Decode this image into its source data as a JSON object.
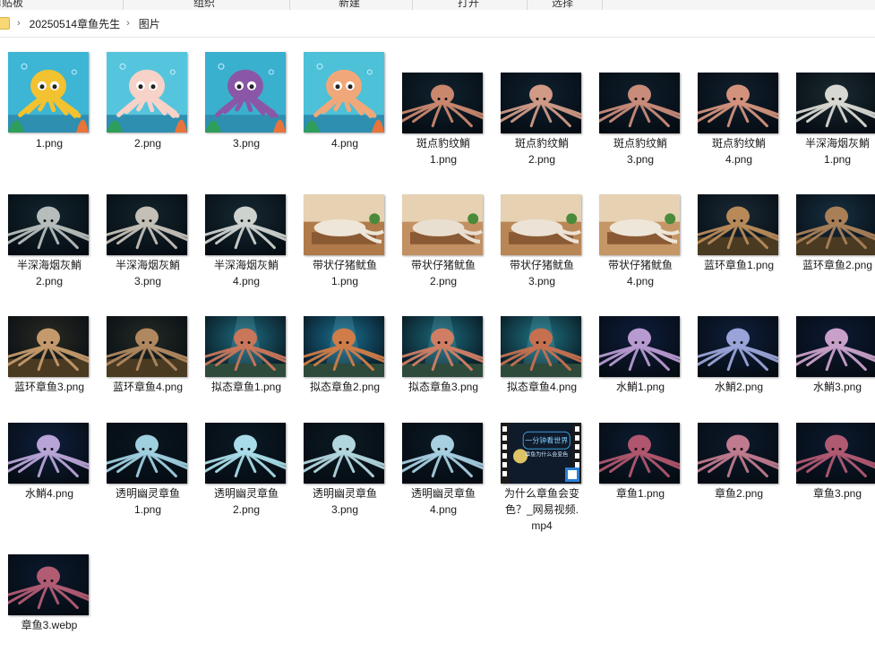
{
  "ribbon": {
    "groups": [
      "剪贴板",
      "组织",
      "新建",
      "打开",
      "选择"
    ]
  },
  "address": {
    "crumbs": [
      "20250514章鱼先生",
      "图片"
    ]
  },
  "colors": {
    "cartoon_bg": "#3fb6d8",
    "dark_bg": "#0d1e2e",
    "selection": "#cce8ff"
  },
  "files": [
    {
      "name": [
        "1.png"
      ],
      "kind": "cartoon",
      "octo": "#f2c230",
      "bg": "#3db5d5"
    },
    {
      "name": [
        "2.png"
      ],
      "kind": "cartoon",
      "octo": "#f7d2c8",
      "bg": "#55c5dd"
    },
    {
      "name": [
        "3.png"
      ],
      "kind": "cartoon",
      "octo": "#8a57a6",
      "bg": "#3ab0cf"
    },
    {
      "name": [
        "4.png"
      ],
      "kind": "cartoon",
      "octo": "#f0a87a",
      "bg": "#4cc1d8"
    },
    {
      "name": [
        "斑点豹纹鮹",
        "1.png"
      ],
      "kind": "dark",
      "octo": "#c9876e",
      "bg": "#10232f"
    },
    {
      "name": [
        "斑点豹纹鮹",
        "2.png"
      ],
      "kind": "dark",
      "octo": "#d09a86",
      "bg": "#0f2130"
    },
    {
      "name": [
        "斑点豹纹鮹",
        "3.png"
      ],
      "kind": "dark",
      "octo": "#c98b7a",
      "bg": "#0e1f2c"
    },
    {
      "name": [
        "斑点豹纹鮹",
        "4.png"
      ],
      "kind": "dark",
      "octo": "#d3927c",
      "bg": "#11202e"
    },
    {
      "name": [
        "半深海烟灰鮹",
        "1.png"
      ],
      "kind": "dark",
      "octo": "#d8d8d2",
      "bg": "#1b2a30"
    },
    {
      "name": [
        "半深海烟灰鮹",
        "2.png"
      ],
      "kind": "dark",
      "octo": "#b7bdbb",
      "bg": "#12262e"
    },
    {
      "name": [
        "半深海烟灰鮹",
        "3.png"
      ],
      "kind": "dark",
      "octo": "#c4c0b6",
      "bg": "#14242c"
    },
    {
      "name": [
        "半深海烟灰鮹",
        "4.png"
      ],
      "kind": "dark",
      "octo": "#cdd2cf",
      "bg": "#162a33"
    },
    {
      "name": [
        "带状仔猪鱿鱼",
        "1.png"
      ],
      "kind": "kitchen",
      "octo": "#eee6d8",
      "bg": "#b07a4a"
    },
    {
      "name": [
        "带状仔猪鱿鱼",
        "2.png"
      ],
      "kind": "kitchen",
      "octo": "#e9dfd1",
      "bg": "#c29062"
    },
    {
      "name": [
        "带状仔猪鱿鱼",
        "3.png"
      ],
      "kind": "kitchen",
      "octo": "#ece3d6",
      "bg": "#b98656"
    },
    {
      "name": [
        "带状仔猪鱿鱼",
        "4.png"
      ],
      "kind": "kitchen",
      "octo": "#efe6da",
      "bg": "#c59766"
    },
    {
      "name": [
        "蓝环章鱼1.png"
      ],
      "kind": "reef",
      "octo": "#b88a5a",
      "bg": "#1a2a35"
    },
    {
      "name": [
        "蓝环章鱼2.png"
      ],
      "kind": "reef",
      "octo": "#a97f58",
      "bg": "#173041"
    },
    {
      "name": [
        "蓝环章鱼3.png"
      ],
      "kind": "reef",
      "octo": "#c49a6c",
      "bg": "#2a2a22"
    },
    {
      "name": [
        "蓝环章鱼4.png"
      ],
      "kind": "reef",
      "octo": "#b08860",
      "bg": "#232a24"
    },
    {
      "name": [
        "拟态章鱼1.png"
      ],
      "kind": "teal",
      "octo": "#c9765a",
      "bg": "#1e6c80"
    },
    {
      "name": [
        "拟态章鱼2.png"
      ],
      "kind": "teal",
      "octo": "#d07c48",
      "bg": "#1a7092"
    },
    {
      "name": [
        "拟态章鱼3.png"
      ],
      "kind": "teal",
      "octo": "#cf7e64",
      "bg": "#1c6a7c"
    },
    {
      "name": [
        "拟态章鱼4.png"
      ],
      "kind": "teal",
      "octo": "#c67050",
      "bg": "#1f7585"
    },
    {
      "name": [
        "水鮹1.png"
      ],
      "kind": "dark",
      "octo": "#b79ad0",
      "bg": "#0e1d3a"
    },
    {
      "name": [
        "水鮹2.png"
      ],
      "kind": "dark",
      "octo": "#9aa4d8",
      "bg": "#0f1e3a"
    },
    {
      "name": [
        "水鮹3.png"
      ],
      "kind": "dark",
      "octo": "#c8a0c8",
      "bg": "#0d1a33"
    },
    {
      "name": [
        "水鮹4.png"
      ],
      "kind": "dark",
      "octo": "#b8a4d6",
      "bg": "#0f1f3c"
    },
    {
      "name": [
        "透明幽灵章鱼",
        "1.png"
      ],
      "kind": "dark",
      "octo": "#9fd0e0",
      "bg": "#0a1620"
    },
    {
      "name": [
        "透明幽灵章鱼",
        "2.png"
      ],
      "kind": "dark",
      "octo": "#a8dce8",
      "bg": "#0b1a24"
    },
    {
      "name": [
        "透明幽灵章鱼",
        "3.png"
      ],
      "kind": "dark",
      "octo": "#b2d6de",
      "bg": "#0c1a22"
    },
    {
      "name": [
        "透明幽灵章鱼",
        "4.png"
      ],
      "kind": "dark",
      "octo": "#a6cfe0",
      "bg": "#0b1924"
    },
    {
      "name": [
        "为什么章鱼会变",
        "色？_网易视频.",
        "mp4"
      ],
      "kind": "video",
      "octo": "#f5d66a",
      "bg": "#0f1a2a"
    },
    {
      "name": [
        "章鱼1.png"
      ],
      "kind": "dark",
      "octo": "#b0566e",
      "bg": "#0c1c30"
    },
    {
      "name": [
        "章鱼2.png"
      ],
      "kind": "dark",
      "octo": "#c07a8e",
      "bg": "#0d1a2c"
    },
    {
      "name": [
        "章鱼3.png"
      ],
      "kind": "dark",
      "octo": "#b05a72",
      "bg": "#0b1a2e"
    },
    {
      "name": [
        "章鱼3.webp"
      ],
      "kind": "dark",
      "octo": "#b25c74",
      "bg": "#0b1a2e"
    }
  ],
  "video": {
    "screen_title": "一分钟看世界",
    "screen_sub": "章鱼为什么会变色"
  }
}
